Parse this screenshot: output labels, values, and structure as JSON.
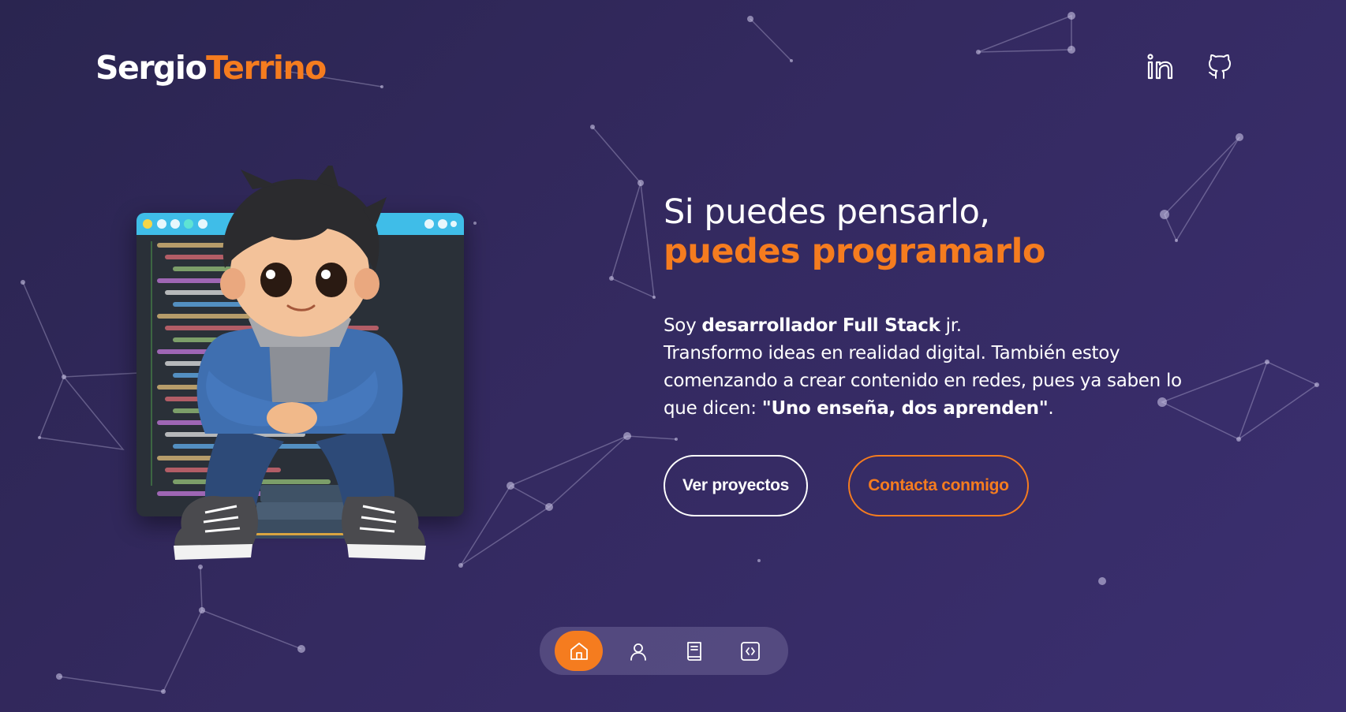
{
  "brand": {
    "first": "Sergio",
    "last": "Terrino"
  },
  "social": [
    {
      "name": "linkedin",
      "icon": "linkedin-icon"
    },
    {
      "name": "github",
      "icon": "github-icon"
    }
  ],
  "hero": {
    "title_line1": "Si puedes pensarlo,",
    "title_line2": "puedes programarlo",
    "desc_soy": "Soy",
    "desc_role": "desarrollador Full Stack",
    "desc_jr": "jr.",
    "desc_body": "Transformo ideas en realidad digital. También estoy comenzando a crear contenido en redes, pues ya saben lo que dicen:",
    "desc_quote": "\"Uno enseña, dos aprenden\"",
    "desc_end": "."
  },
  "buttons": {
    "projects": "Ver proyectos",
    "contact": "Contacta conmigo"
  },
  "bottom_nav": [
    {
      "icon": "home-icon",
      "active": true
    },
    {
      "icon": "user-icon",
      "active": false
    },
    {
      "icon": "book-icon",
      "active": false
    },
    {
      "icon": "code-icon",
      "active": false
    }
  ],
  "colors": {
    "accent": "#f57c1f",
    "text": "#ffffff",
    "background": "#2f2858"
  }
}
